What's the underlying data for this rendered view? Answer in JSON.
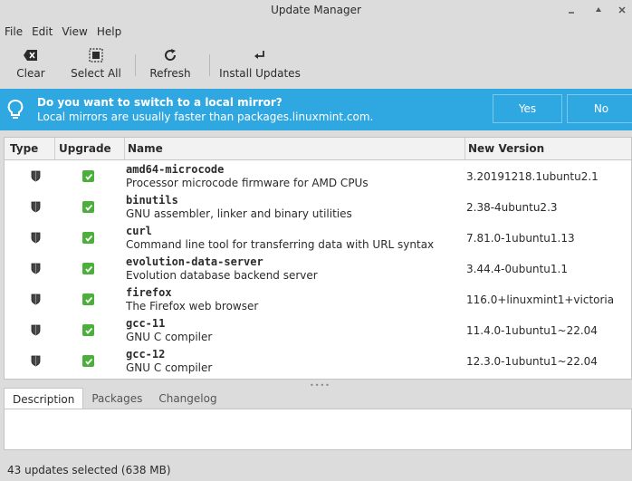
{
  "window": {
    "title": "Update Manager"
  },
  "menu": [
    "File",
    "Edit",
    "View",
    "Help"
  ],
  "toolbar": {
    "clear": "Clear",
    "select_all": "Select All",
    "refresh": "Refresh",
    "install": "Install Updates"
  },
  "infobar": {
    "question": "Do you want to switch to a local mirror?",
    "subtitle": "Local mirrors are usually faster than packages.linuxmint.com.",
    "yes": "Yes",
    "no": "No",
    "color": "#2fa7e0"
  },
  "table": {
    "columns": [
      "Type",
      "Upgrade",
      "Name",
      "New Version"
    ],
    "rows": [
      {
        "name": "amd64-microcode",
        "desc": "Processor microcode firmware for AMD CPUs",
        "version": "3.20191218.1ubuntu2.1",
        "type_icon": "shield-icon",
        "checked": true
      },
      {
        "name": "binutils",
        "desc": "GNU assembler, linker and binary utilities",
        "version": "2.38-4ubuntu2.3",
        "type_icon": "shield-icon",
        "checked": true
      },
      {
        "name": "curl",
        "desc": "Command line tool for transferring data with URL syntax",
        "version": "7.81.0-1ubuntu1.13",
        "type_icon": "shield-icon",
        "checked": true
      },
      {
        "name": "evolution-data-server",
        "desc": "Evolution database backend server",
        "version": "3.44.4-0ubuntu1.1",
        "type_icon": "shield-icon",
        "checked": true
      },
      {
        "name": "firefox",
        "desc": "The Firefox web browser",
        "version": "116.0+linuxmint1+victoria",
        "type_icon": "shield-icon",
        "checked": true
      },
      {
        "name": "gcc-11",
        "desc": "GNU C compiler",
        "version": "11.4.0-1ubuntu1~22.04",
        "type_icon": "shield-icon",
        "checked": true
      },
      {
        "name": "gcc-12",
        "desc": "GNU C compiler",
        "version": "12.3.0-1ubuntu1~22.04",
        "type_icon": "shield-icon",
        "checked": true
      }
    ]
  },
  "tabs": [
    "Description",
    "Packages",
    "Changelog"
  ],
  "status": "43 updates selected (638 MB)"
}
